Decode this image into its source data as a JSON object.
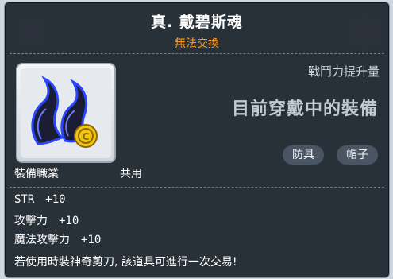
{
  "item": {
    "name": "真. 戴碧斯魂",
    "trade_status": "無法交換",
    "power_increase_label": "戰鬥力提升量",
    "equipped_label": "目前穿戴中的裝備",
    "tags": [
      "防具",
      "帽子"
    ]
  },
  "job": {
    "label": "裝備職業",
    "value": "共用"
  },
  "stats": [
    {
      "name": "STR",
      "value": "+10"
    },
    {
      "name": "攻擊力",
      "value": "+10"
    },
    {
      "name": "魔法攻擊力",
      "value": "+10"
    }
  ],
  "note": "若使用時裝神奇剪刀, 該道具可進行一次交易!",
  "colors": {
    "title": "#ffffff",
    "trade_status": "#ff9a1f",
    "panel": "#1e252e"
  }
}
